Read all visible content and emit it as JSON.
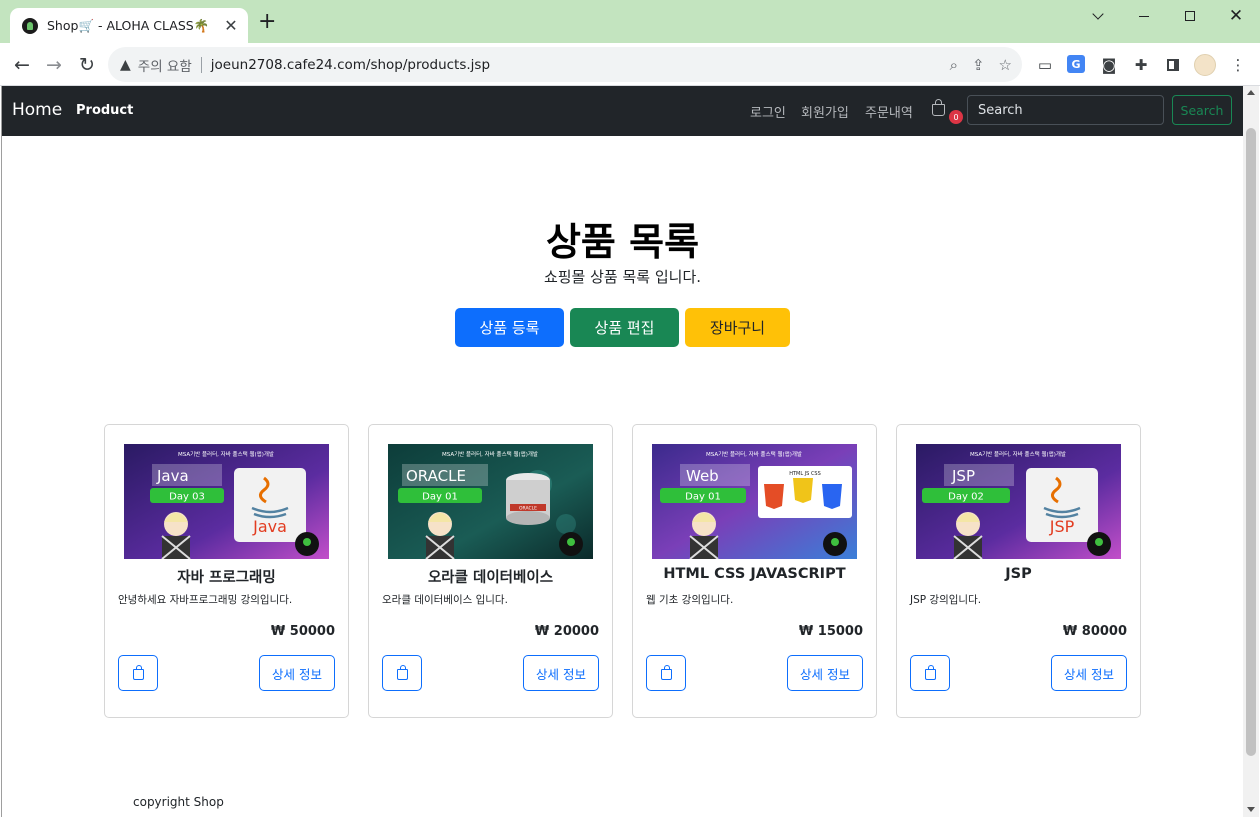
{
  "browser": {
    "tab_title": "Shop🛒 - ALOHA CLASS🌴",
    "tab_close": "✕",
    "new_tab": "+",
    "security_label": "주의 요함",
    "url": "joeun2708.cafe24.com/shop/products.jsp"
  },
  "navbar": {
    "brand": "Home",
    "product": "Product",
    "login": "로그인",
    "join": "회원가입",
    "orders": "주문내역",
    "cart_count": "0",
    "search_placeholder": "Search",
    "search_button": "Search"
  },
  "hero": {
    "title": "상품 목록",
    "subtitle": "쇼핑몰 상품 목록 입니다.",
    "add_button": "상품 등록",
    "edit_button": "상품 편집",
    "cart_button": "장바구니"
  },
  "products": [
    {
      "name": "자바 프로그래밍",
      "desc": "안녕하세요 자바프로그래밍 강의입니다.",
      "price": "₩ 50000",
      "thumb_header": "MSA기반 플러터, 자바 풀스택 웹(앱)개발",
      "thumb_subject": "Java",
      "thumb_day": "Day 03",
      "thumb_logo": "Java",
      "detail_label": "상세 정보"
    },
    {
      "name": "오라클 데이터베이스",
      "desc": "오라클 데이터베이스 입니다.",
      "price": "₩ 20000",
      "thumb_header": "MSA기반 플러터, 자바 풀스택 웹(앱)개발",
      "thumb_subject": "ORACLE",
      "thumb_day": "Day 01",
      "thumb_logo": "ORACLE",
      "detail_label": "상세 정보"
    },
    {
      "name": "HTML CSS JAVASCRIPT",
      "desc": "웹 기초 강의입니다.",
      "price": "₩ 15000",
      "thumb_header": "MSA기반 플러터, 자바 풀스택 웹(앱)개발",
      "thumb_subject": "Web",
      "thumb_day": "Day 01",
      "thumb_logo": "HTML JS CSS",
      "detail_label": "상세 정보"
    },
    {
      "name": "JSP",
      "desc": "JSP 강의입니다.",
      "price": "₩ 80000",
      "thumb_header": "MSA기반 플러터, 자바 풀스택 웹(앱)개발",
      "thumb_subject": "JSP",
      "thumb_day": "Day 02",
      "thumb_logo": "JSP",
      "detail_label": "상세 정보"
    }
  ],
  "footer": "copyright Shop",
  "colors": {
    "primary": "#0d6efd",
    "success": "#198754",
    "warning": "#ffc107",
    "dark": "#212529",
    "danger": "#dc3545",
    "chrome_frame": "#c3e4bf"
  }
}
